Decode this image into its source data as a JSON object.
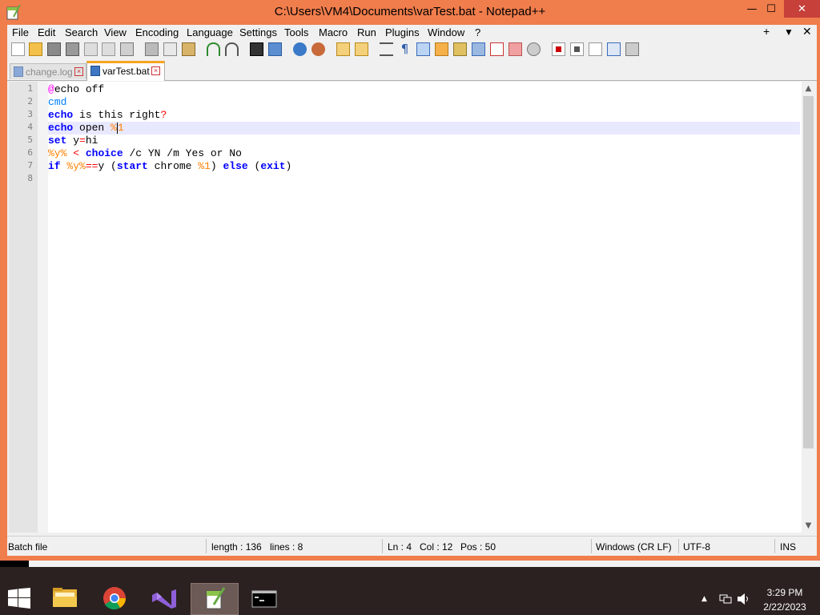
{
  "window": {
    "title": "C:\\Users\\VM4\\Documents\\varTest.bat - Notepad++",
    "minimize_glyph": "—",
    "maximize_glyph": "☐",
    "close_glyph": "✕"
  },
  "menu": {
    "items": [
      "File",
      "Edit",
      "Search",
      "View",
      "Encoding",
      "Language",
      "Settings",
      "Tools",
      "Macro",
      "Run",
      "Plugins",
      "Window",
      "?"
    ],
    "right": [
      "+",
      "▼",
      "✕"
    ]
  },
  "tabs": [
    {
      "label": "change.log",
      "active": false
    },
    {
      "label": "varTest.bat",
      "active": true
    }
  ],
  "editor": {
    "line_numbers": [
      "1",
      "2",
      "3",
      "4",
      "5",
      "6",
      "7",
      "8"
    ],
    "current_line": 4,
    "lines": [
      [
        {
          "t": "@",
          "c": "at"
        },
        {
          "t": "echo off",
          "c": "kw-plain"
        }
      ],
      [
        {
          "t": "cmd",
          "c": "cyan"
        }
      ],
      [
        {
          "t": "echo",
          "c": "kw"
        },
        {
          "t": " is this right",
          "c": "pl"
        },
        {
          "t": "?",
          "c": "q"
        }
      ],
      [
        {
          "t": "echo",
          "c": "kw"
        },
        {
          "t": " open ",
          "c": "pl"
        },
        {
          "t": "%1",
          "c": "var"
        }
      ],
      [
        {
          "t": "set",
          "c": "kw"
        },
        {
          "t": " y",
          "c": "pl"
        },
        {
          "t": "=",
          "c": "op"
        },
        {
          "t": "hi",
          "c": "pl"
        }
      ],
      [
        {
          "t": "%y%",
          "c": "var"
        },
        {
          "t": " ",
          "c": "pl"
        },
        {
          "t": "<",
          "c": "op"
        },
        {
          "t": " ",
          "c": "pl"
        },
        {
          "t": "choice",
          "c": "kw"
        },
        {
          "t": " /c YN /m Yes or No",
          "c": "pl"
        }
      ],
      [
        {
          "t": "if",
          "c": "kw"
        },
        {
          "t": " ",
          "c": "pl"
        },
        {
          "t": "%y%",
          "c": "var"
        },
        {
          "t": "==",
          "c": "op"
        },
        {
          "t": "y (",
          "c": "pl"
        },
        {
          "t": "start",
          "c": "kw"
        },
        {
          "t": " chrome ",
          "c": "pl"
        },
        {
          "t": "%1",
          "c": "var"
        },
        {
          "t": ") ",
          "c": "pl"
        },
        {
          "t": "else",
          "c": "kw"
        },
        {
          "t": " (",
          "c": "pl"
        },
        {
          "t": "exit",
          "c": "kw"
        },
        {
          "t": ")",
          "c": "pl"
        }
      ],
      []
    ]
  },
  "status": {
    "type": "Batch file",
    "length": "length : 136",
    "lines": "lines : 8",
    "ln": "Ln : 4",
    "col": "Col : 12",
    "pos": "Pos : 50",
    "eol": "Windows (CR LF)",
    "encoding": "UTF-8",
    "mode": "INS"
  },
  "tray": {
    "time": "3:29 PM",
    "date": "2/22/2023",
    "chevron": "▲"
  },
  "colors": {
    "accent": "#f07d4c",
    "keyword": "#0000ff",
    "variable": "#ff8000",
    "operator": "#ff0000"
  }
}
